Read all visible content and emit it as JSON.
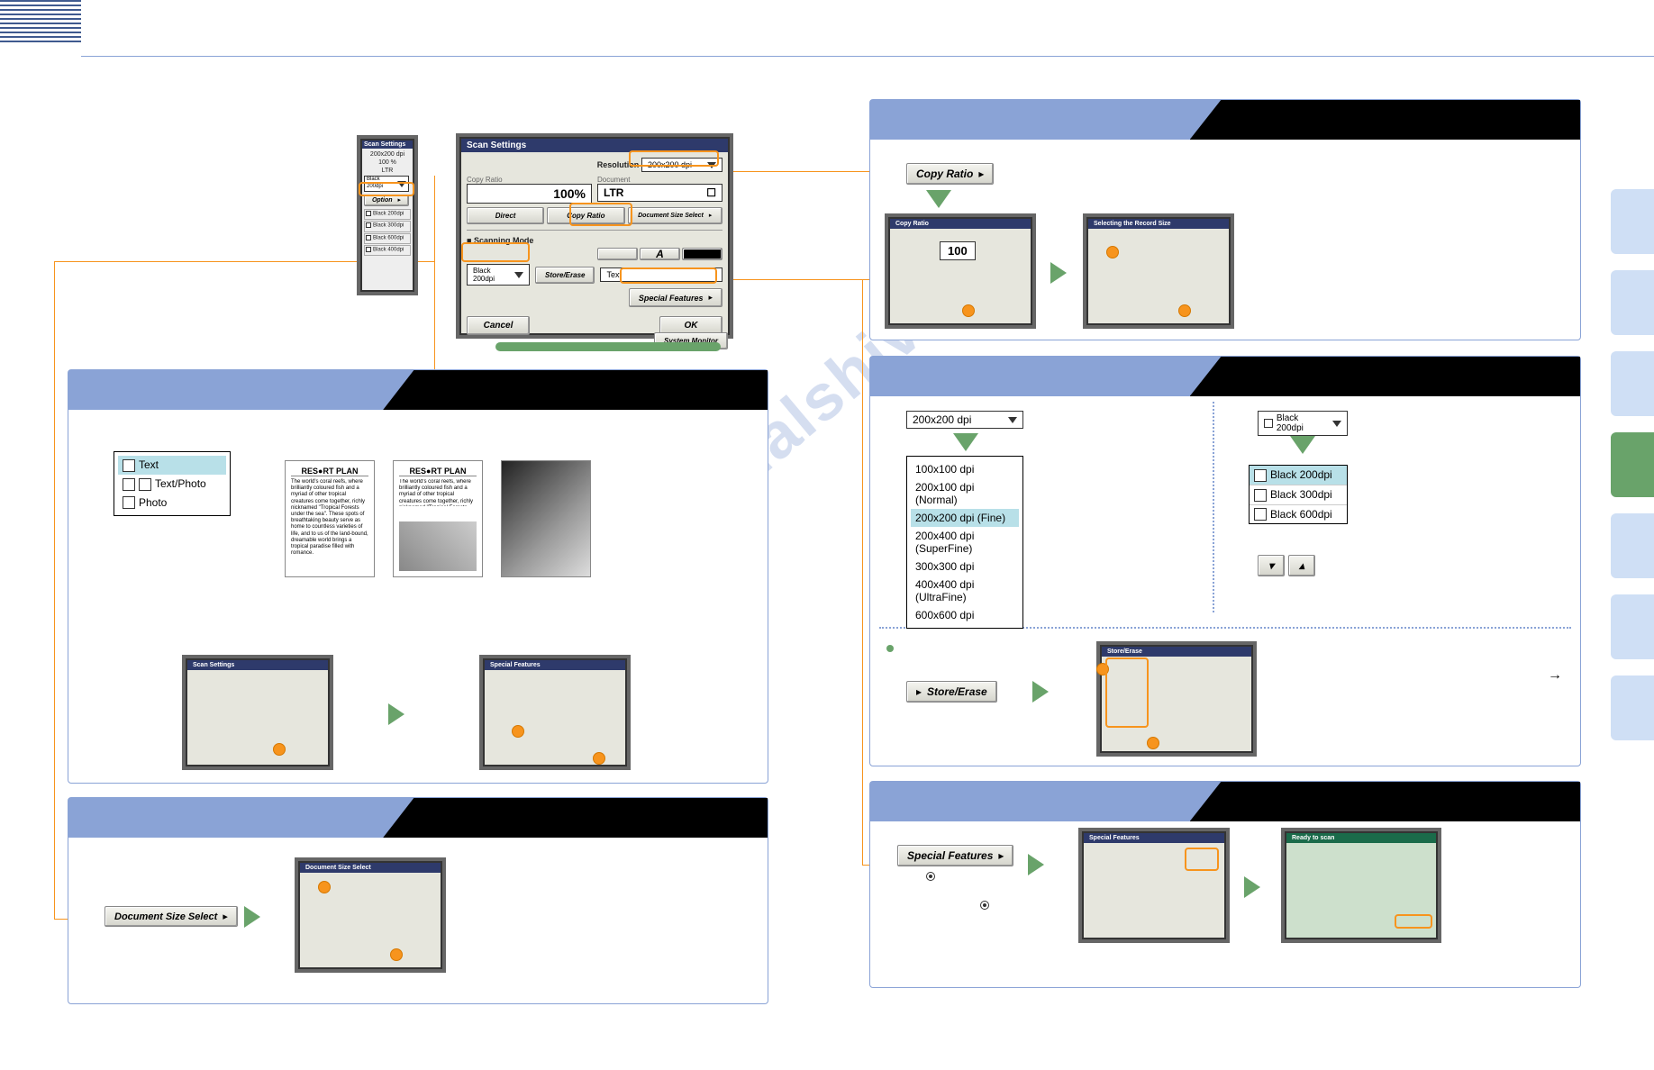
{
  "watermark": "manualshive.com",
  "side": {
    "tabs": [
      "",
      "",
      "",
      "",
      "",
      "",
      ""
    ]
  },
  "top": {
    "scan_settings_title": "Scan Settings",
    "side_panel_title": "Scan Settings",
    "side_values": {
      "ratio": "200x200 dpi",
      "pct": "100 %",
      "doc": "LTR"
    },
    "side_mode": "Black 200dpi",
    "option_label": "Option",
    "presets": [
      "Black 200dpi",
      "Black 300dpi",
      "Black 600dpi",
      "Black 400dpi"
    ],
    "resolution_label": "Resolution",
    "resolution_value": "200x200 dpi",
    "copy_ratio_label": "Copy Ratio",
    "copy_ratio_value": "100%",
    "document_label": "Document",
    "document_value": "LTR",
    "scale_btns": [
      "Direct",
      "Copy Ratio",
      "Document Size Select"
    ],
    "scanning_mode_label": "Scanning Mode",
    "mode_value": "Black 200dpi",
    "store_erase": "Store/Erase",
    "text_tag": "Text",
    "special_features": "Special Features",
    "cancel": "Cancel",
    "ok": "OK",
    "system_monitor": "System Monitor"
  },
  "p1": {
    "options": [
      "Text",
      "Text/Photo",
      "Photo"
    ],
    "sample_title": "RES●RT PLAN",
    "sample_text": "The world's coral reefs, where brilliantly coloured fish and a myriad of other tropical creatures come together, richly nicknamed \"Tropical Forests under the sea\". These spots of breathtaking beauty serve as home to countless varieties of life, and to us of the land-bound, dreamable world brings a tropical paradise filled with romance."
  },
  "p2": {
    "btn_label": "Document Size Select"
  },
  "p3": {
    "btn_label": "Copy Ratio",
    "value_100": "100"
  },
  "p4": {
    "dd_value": "200x200 dpi",
    "options": [
      "100x100 dpi",
      "200x100 dpi (Normal)",
      "200x200 dpi (Fine)",
      "200x400 dpi (SuperFine)",
      "300x300 dpi",
      "400x400 dpi (UltraFine)",
      "600x600 dpi"
    ],
    "sel": 2,
    "preset_dd": "Black 200dpi",
    "presets": [
      "Black 200dpi",
      "Black 300dpi",
      "Black 600dpi"
    ],
    "store_erase": "Store/Erase"
  },
  "p5": {
    "btn_label": "Special Features"
  }
}
